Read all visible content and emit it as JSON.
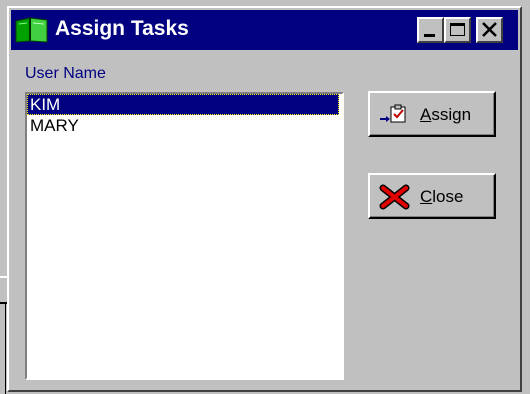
{
  "window": {
    "title": "Assign Tasks",
    "controls": [
      "minimize-icon",
      "maximize-icon",
      "close-icon"
    ]
  },
  "users": {
    "label": "User Name",
    "items": [
      {
        "name": "KIM",
        "selected": true
      },
      {
        "name": "MARY",
        "selected": false
      }
    ]
  },
  "buttons": {
    "assign": {
      "label": "Assign",
      "accel": "A",
      "icon": "assign-task-icon"
    },
    "close": {
      "label": "Close",
      "accel": "C",
      "icon": "red-x-icon"
    }
  },
  "colors": {
    "titlebar": "#000080",
    "face": "#c0c0c0",
    "selection": "#000080",
    "label": "#000080"
  }
}
